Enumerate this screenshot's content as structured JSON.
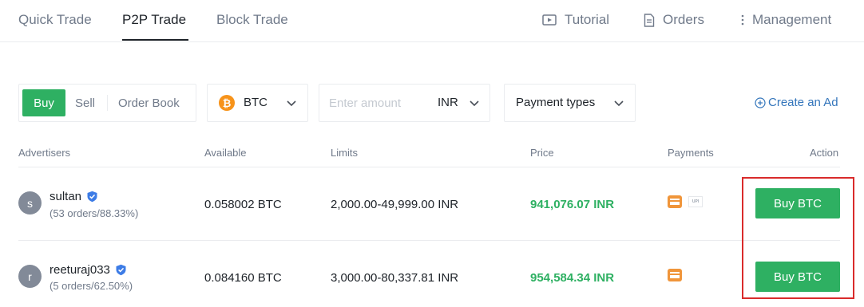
{
  "tabs": [
    {
      "label": "Quick Trade",
      "active": false
    },
    {
      "label": "P2P Trade",
      "active": true
    },
    {
      "label": "Block Trade",
      "active": false
    }
  ],
  "nav_links": {
    "tutorial": "Tutorial",
    "orders": "Orders",
    "management": "Management"
  },
  "filters": {
    "side_buy": "Buy",
    "side_sell": "Sell",
    "order_book": "Order Book",
    "coin": "BTC",
    "coin_icon": "bitcoin-icon",
    "amount_placeholder": "Enter amount",
    "amount_value": "",
    "currency": "INR",
    "payment_types": "Payment types",
    "create_ad": "Create an Ad"
  },
  "table": {
    "headers": [
      "Advertisers",
      "Available",
      "Limits",
      "Price",
      "Payments",
      "Action"
    ],
    "rows": [
      {
        "avatar_letter": "s",
        "name": "sultan",
        "verified": true,
        "stats": "(53 orders/88.33%)",
        "available": "0.058002 BTC",
        "limits": "2,000.00-49,999.00 INR",
        "price": "941,076.07 INR",
        "payments": [
          "bank-transfer-icon",
          "upi-icon"
        ],
        "payment_badge_text": "UPI",
        "action": "Buy BTC"
      },
      {
        "avatar_letter": "r",
        "name": "reeturaj033",
        "verified": true,
        "stats": "(5 orders/62.50%)",
        "available": "0.084160 BTC",
        "limits": "3,000.00-80,337.81 INR",
        "price": "954,584.34 INR",
        "payments": [
          "bank-transfer-icon"
        ],
        "action": "Buy BTC"
      }
    ]
  },
  "colors": {
    "buy_green": "#2eb062",
    "link_blue": "#3375bb",
    "highlight_red": "#d92b2b",
    "bitcoin_orange": "#f7931a"
  }
}
